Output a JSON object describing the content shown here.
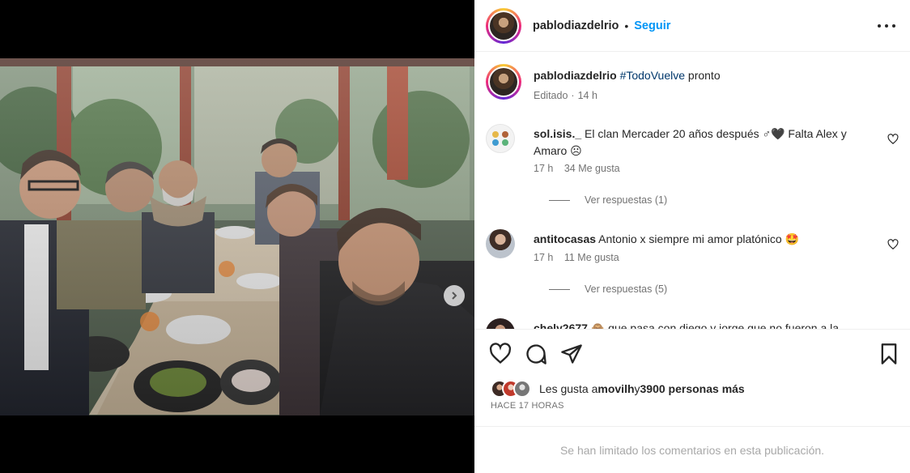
{
  "post": {
    "username": "pablodiazdelrio",
    "follow_label": "Seguir",
    "separator": "•"
  },
  "caption": {
    "username": "pablodiazdelrio",
    "hashtag": "#TodoVuelve",
    "text": " pronto",
    "edited": "Editado",
    "time": "14 h",
    "meta_sep": "·"
  },
  "comments": [
    {
      "username": "sol.isis._",
      "text": "El clan Mercader 20 años después ♂🖤 Falta Alex y Amaro ☹",
      "time": "17 h",
      "likes": "34 Me gusta",
      "replies": "Ver respuestas (1)"
    },
    {
      "username": "antitocasas",
      "text": "Antonio x siempre mi amor platónico 🤩",
      "time": "17 h",
      "likes": "11 Me gusta",
      "replies": "Ver respuestas (5)"
    },
    {
      "username": "chely2677",
      "text": "🙈 que pasa con diego y jorge que no fueron a la"
    }
  ],
  "likes": {
    "prefix": "Les gusta a ",
    "user": "movilh",
    "middle": " y ",
    "count": "3900 personas más"
  },
  "time_ago": "HACE 17 HORAS",
  "footer": "Se han limitado los comentarios en esta publicación.",
  "carousel": {
    "slides": 2,
    "active": 0
  },
  "icons": {
    "more": "more-options-icon",
    "like": "heart-icon",
    "comment": "comment-bubble-icon",
    "share": "paper-plane-icon",
    "save": "bookmark-icon",
    "next": "chevron-right-icon",
    "tag": "user-tag-icon"
  },
  "colors": {
    "accent": "#0095f6",
    "hashtag": "#00376b",
    "muted": "#737373"
  }
}
